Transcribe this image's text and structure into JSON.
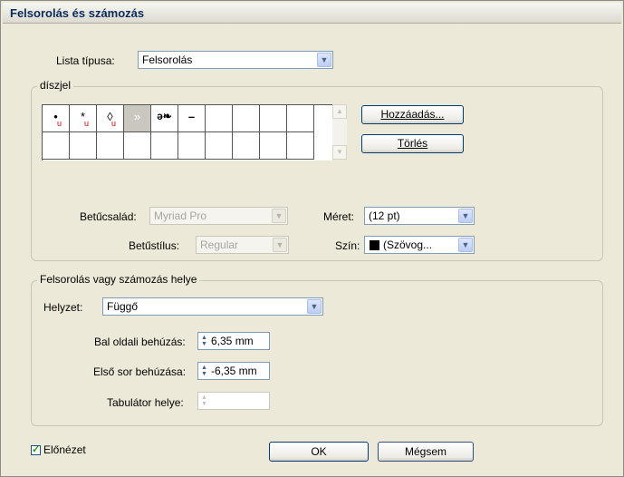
{
  "window": {
    "title": "Felsorolás és számozás"
  },
  "list_type": {
    "label": "Lista típusa:",
    "value": "Felsorolás"
  },
  "bullet_group": {
    "legend": "díszjel",
    "cells": [
      {
        "glyph": "•",
        "unicode_mark": "u"
      },
      {
        "glyph": "*",
        "unicode_mark": "u"
      },
      {
        "glyph": "◊",
        "unicode_mark": "u"
      },
      {
        "glyph": "»",
        "unicode_mark": "",
        "selected": true
      },
      {
        "glyph": "ə❧",
        "unicode_mark": ""
      },
      {
        "glyph": "–",
        "unicode_mark": ""
      }
    ],
    "add_button": "Hozzáadás...",
    "delete_button": "Törlés",
    "font_family_label": "Betűcsalád:",
    "font_family_value": "Myriad Pro",
    "font_style_label": "Betűstílus:",
    "font_style_value": "Regular",
    "size_label": "Méret:",
    "size_value": "(12 pt)",
    "color_label": "Szín:",
    "color_value": "(Szövog...",
    "color_swatch": "#000000"
  },
  "position_group": {
    "legend": "Felsorolás vagy számozás helye",
    "position_label": "Helyzet:",
    "position_value": "Függő",
    "left_indent_label": "Bal oldali behúzás:",
    "left_indent_value": "6,35 mm",
    "first_line_label": "Első sor behúzása:",
    "first_line_value": "-6,35 mm",
    "tab_position_label": "Tabulátor helye:",
    "tab_position_value": ""
  },
  "footer": {
    "preview_label": "Előnézet",
    "preview_checked": true,
    "ok_button": "OK",
    "cancel_button": "Mégsem"
  }
}
